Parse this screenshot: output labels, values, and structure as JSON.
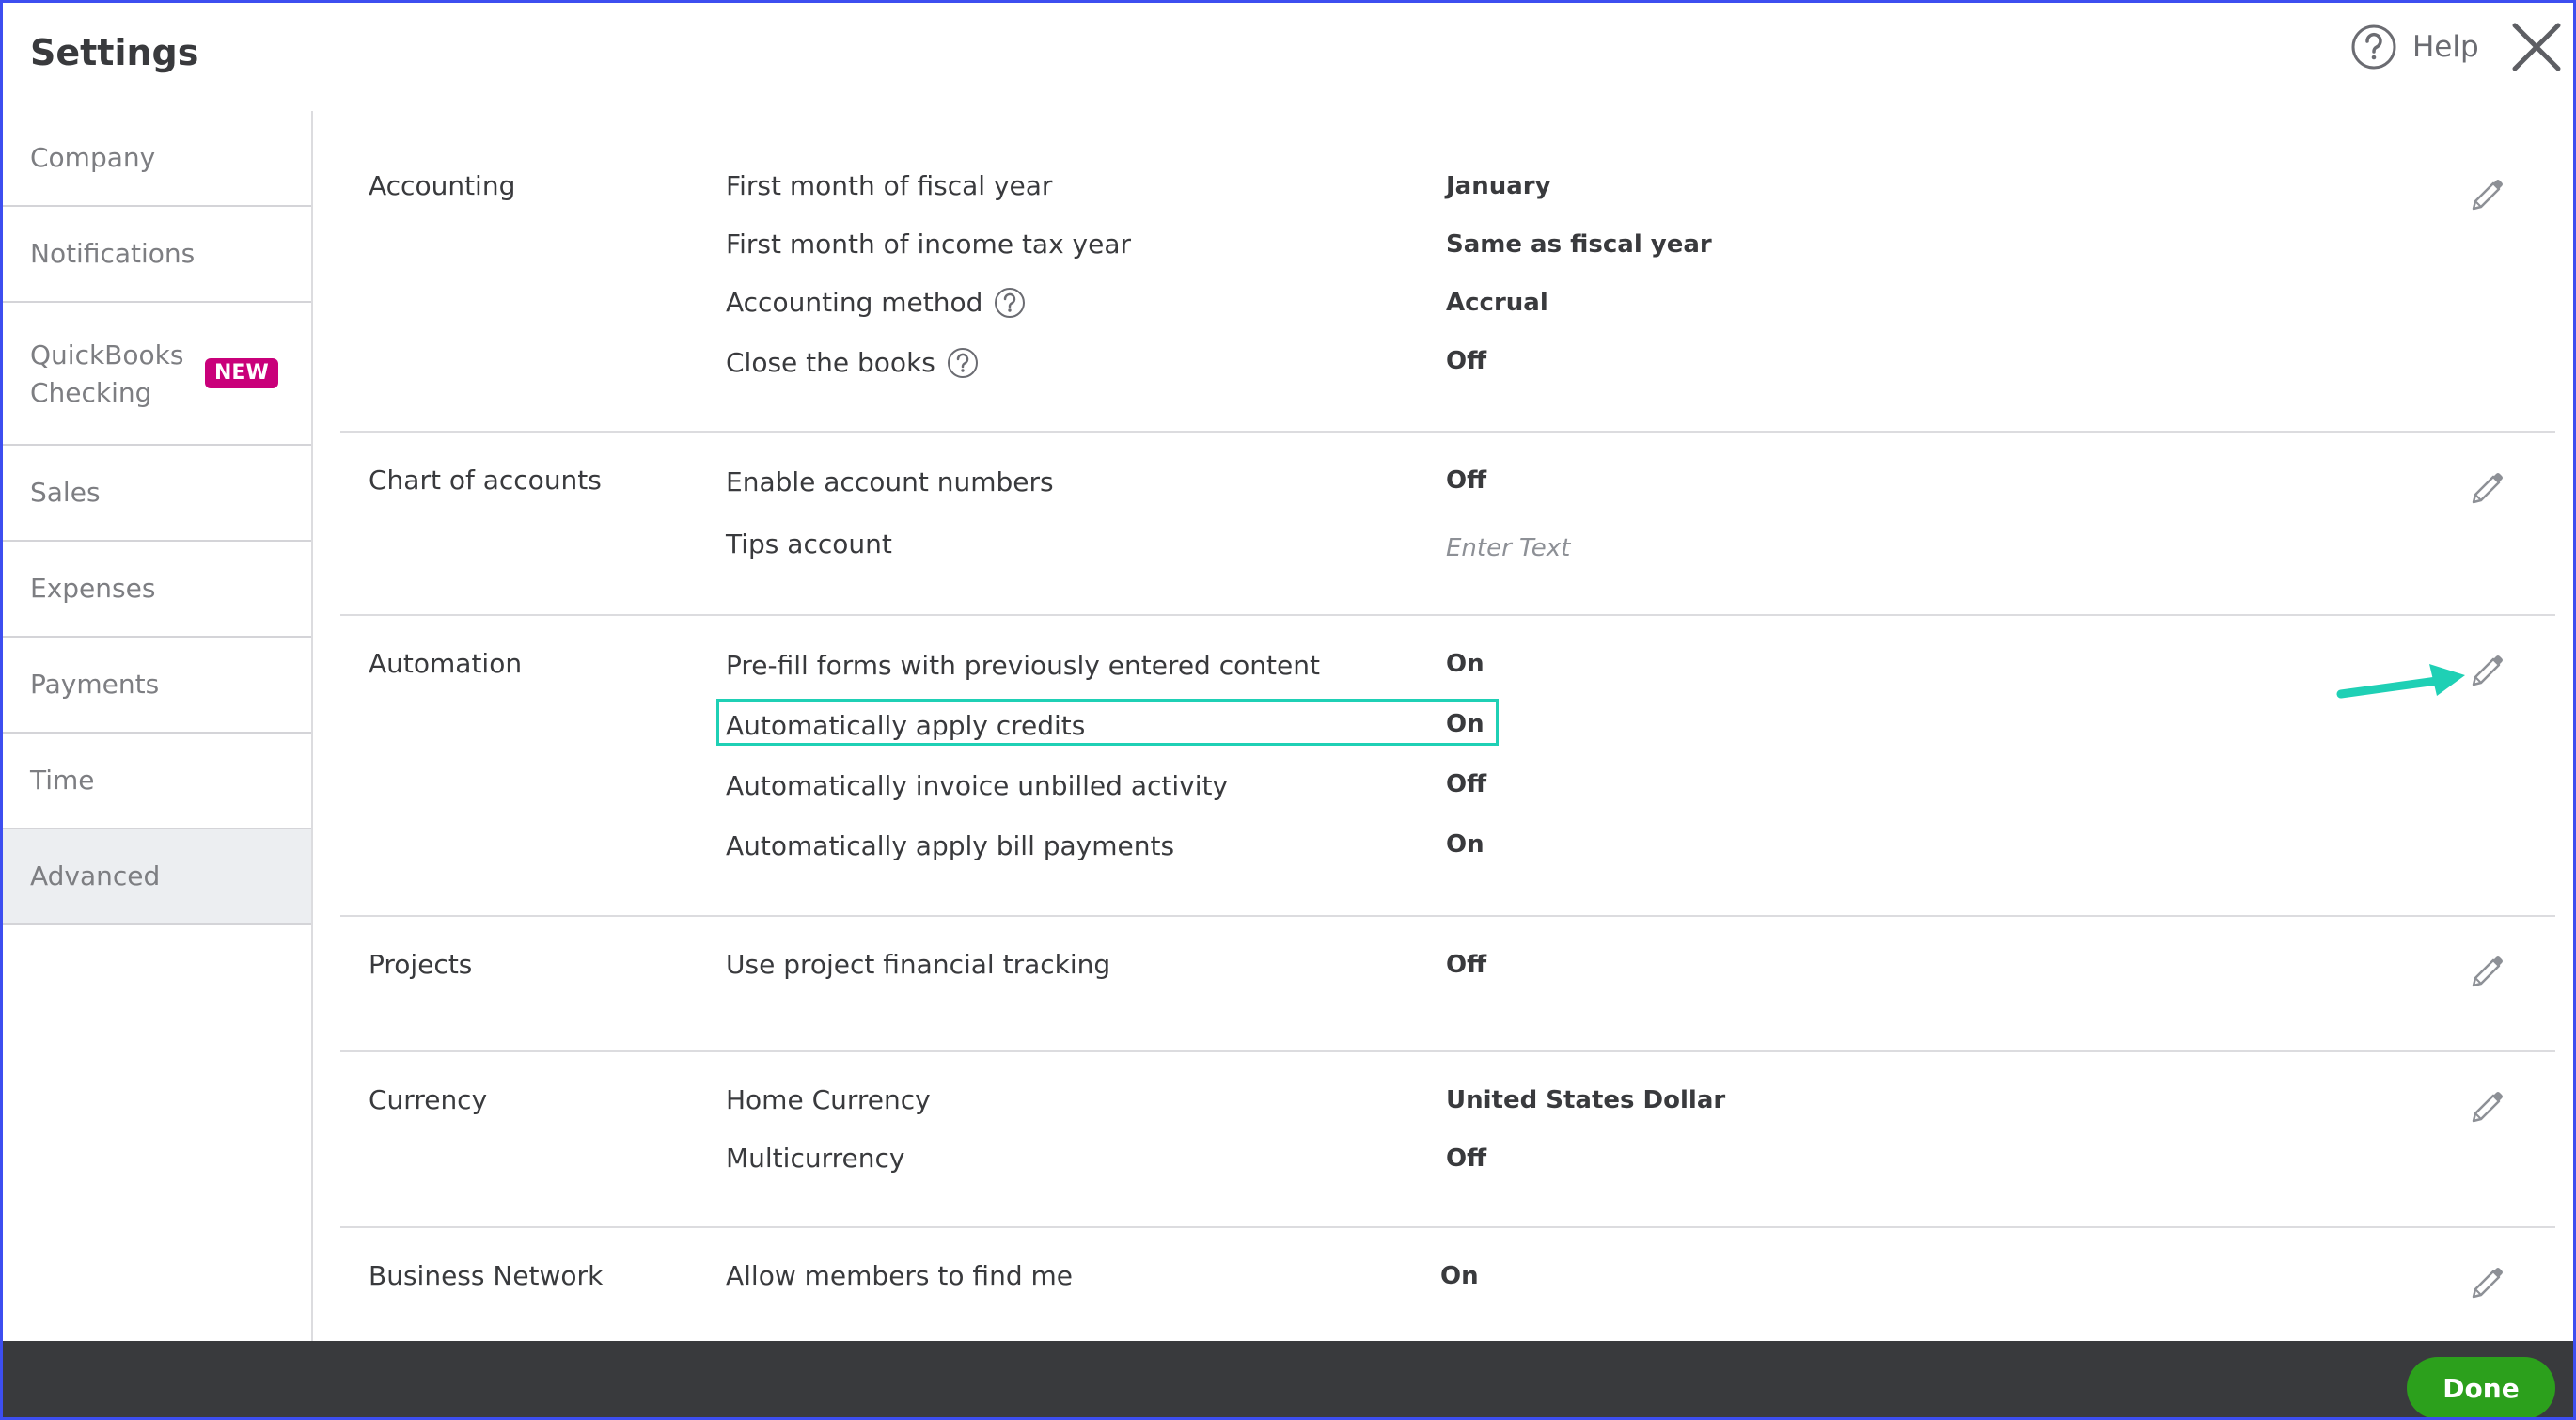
{
  "header": {
    "title": "Settings",
    "help_label": "Help"
  },
  "sidebar": {
    "items": [
      {
        "label": "Company",
        "active": false
      },
      {
        "label": "Notifications",
        "active": false
      },
      {
        "label": "QuickBooks Checking",
        "badge": "NEW",
        "active": false
      },
      {
        "label": "Sales",
        "active": false
      },
      {
        "label": "Expenses",
        "active": false
      },
      {
        "label": "Payments",
        "active": false
      },
      {
        "label": "Time",
        "active": false
      },
      {
        "label": "Advanced",
        "active": true
      }
    ]
  },
  "sections": [
    {
      "title": "Accounting",
      "rows": [
        {
          "label": "First month of fiscal year",
          "value": "January"
        },
        {
          "label": "First month of income tax year",
          "value": "Same as fiscal year"
        },
        {
          "label": "Accounting method",
          "value": "Accrual",
          "help_icon": true
        },
        {
          "label": "Close the books",
          "value": "Off",
          "help_icon": true
        }
      ]
    },
    {
      "title": "Chart of accounts",
      "rows": [
        {
          "label": "Enable account numbers",
          "value": "Off"
        },
        {
          "label": "Tips account",
          "placeholder": "Enter Text"
        }
      ]
    },
    {
      "title": "Automation",
      "rows": [
        {
          "label": "Pre-fill forms with previously entered content",
          "value": "On"
        },
        {
          "label": "Automatically apply credits",
          "value": "On",
          "highlighted": true
        },
        {
          "label": "Automatically invoice unbilled activity",
          "value": "Off"
        },
        {
          "label": "Automatically apply bill payments",
          "value": "On"
        }
      ]
    },
    {
      "title": "Projects",
      "rows": [
        {
          "label": "Use project financial tracking",
          "value": "Off"
        }
      ]
    },
    {
      "title": "Currency",
      "rows": [
        {
          "label": "Home Currency",
          "value": "United States Dollar"
        },
        {
          "label": "Multicurrency",
          "value": "Off"
        }
      ]
    },
    {
      "title": "Business Network",
      "rows": [
        {
          "label": "Allow members to find me",
          "value": "On"
        }
      ]
    }
  ],
  "footer": {
    "done_label": "Done"
  },
  "colors": {
    "accent_green": "#2ca01c",
    "badge_magenta": "#c9007a",
    "annotation_teal": "#1fd0b5",
    "frame_blue": "#3d4ef0",
    "footer_dark": "#393a3d"
  },
  "icons": {
    "help": "question-circle-icon",
    "close": "close-x-icon",
    "edit": "pencil-icon",
    "annotation": "arrow-annotation"
  }
}
